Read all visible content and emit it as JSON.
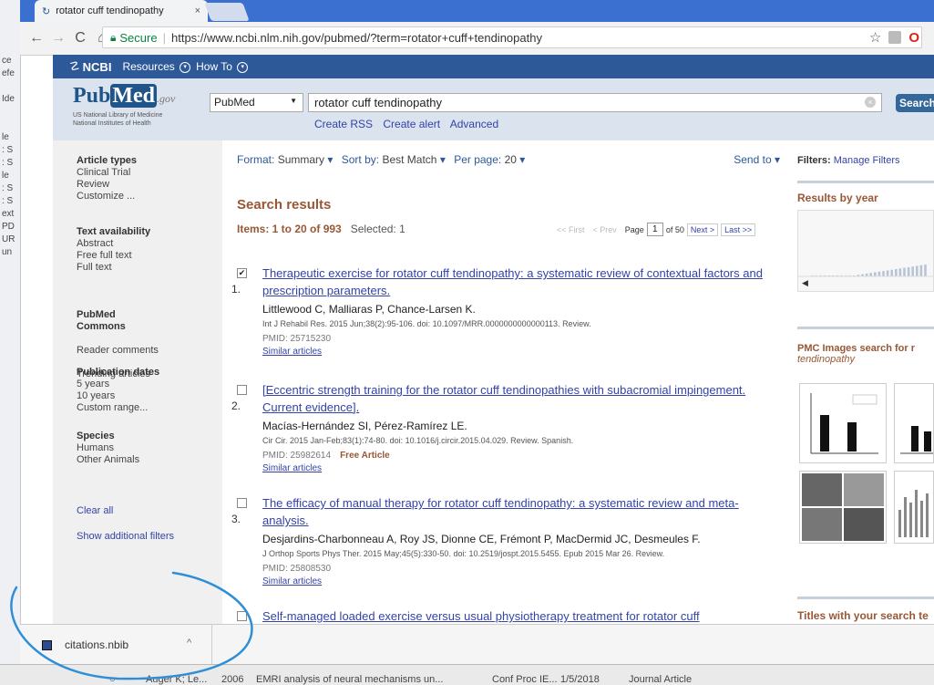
{
  "bg_window": {
    "lines": [
      "ce",
      "efe",
      "",
      "Ide",
      "",
      "",
      "le",
      ": S",
      ": S",
      "le",
      ": S",
      ": S",
      "ext",
      "PD",
      "UR",
      "un"
    ]
  },
  "browser": {
    "tab_title": "rotator cuff tendinopathy",
    "tab_close": "×",
    "secure_label": "Secure",
    "url": "https://www.ncbi.nlm.nih.gov/pubmed/?term=rotator+cuff+tendinopathy"
  },
  "ncbi": {
    "logo": "NCBI",
    "resources": "Resources",
    "howto": "How To"
  },
  "header": {
    "logo_pub": "Pub",
    "logo_med": "Med",
    "logo_gov": ".gov",
    "logo_sub1": "US National Library of Medicine",
    "logo_sub2": "National Institutes of Health",
    "database": "PubMed",
    "query": "rotator cuff tendinopathy",
    "search_label": "Search",
    "links": [
      "Create RSS",
      "Create alert",
      "Advanced"
    ]
  },
  "sidebar": {
    "sections": [
      {
        "title": "Article types",
        "items": [
          "Clinical Trial",
          "Review",
          "Customize ..."
        ]
      },
      {
        "title": "Text availability",
        "items": [
          "Abstract",
          "Free full text",
          "Full text"
        ]
      },
      {
        "title": "PubMed\nCommons",
        "items": [
          "Reader comments",
          "Trending articles"
        ]
      },
      {
        "title": "Publication dates",
        "items": [
          "5 years",
          "10 years",
          "Custom range..."
        ]
      },
      {
        "title": "Species",
        "items": [
          "Humans",
          "Other Animals"
        ]
      }
    ],
    "clear_all": "Clear all",
    "show_filters": "Show additional filters"
  },
  "results_bar": {
    "format_label": "Format:",
    "format_value": "Summary",
    "sort_label": "Sort by:",
    "sort_value": "Best Match",
    "perpage_label": "Per page:",
    "perpage_value": "20",
    "send_to": "Send to"
  },
  "results": {
    "title": "Search results",
    "items_label": "Items: 1 to 20 of 993",
    "selected": "Selected: 1",
    "pager": {
      "first": "<< First",
      "prev": "< Prev",
      "page_label": "Page",
      "page": "1",
      "of": "of 50",
      "next": "Next >",
      "last": "Last >>"
    },
    "list": [
      {
        "num": "1.",
        "checked": true,
        "title": "Therapeutic exercise for rotator cuff tendinopathy: a systematic review of contextual factors and prescription parameters.",
        "authors": "Littlewood C, Malliaras P, Chance-Larsen K.",
        "citation": "Int J Rehabil Res. 2015 Jun;38(2):95-106. doi: 10.1097/MRR.0000000000000113. Review.",
        "pmid": "PMID: 25715230",
        "free": "",
        "similar": "Similar articles"
      },
      {
        "num": "2.",
        "checked": false,
        "title": "[Eccentric strength training for the rotator cuff tendinopathies with subacromial impingement. Current evidence].",
        "authors": "Macías-Hernández SI, Pérez-Ramírez LE.",
        "citation": "Cir Cir. 2015 Jan-Feb;83(1):74-80. doi: 10.1016/j.circir.2015.04.029. Review. Spanish.",
        "pmid": "PMID: 25982614",
        "free": "Free Article",
        "similar": "Similar articles"
      },
      {
        "num": "3.",
        "checked": false,
        "title": "The efficacy of manual therapy for rotator cuff tendinopathy: a systematic review and meta-analysis.",
        "authors": "Desjardins-Charbonneau A, Roy JS, Dionne CE, Frémont P, MacDermid JC, Desmeules F.",
        "citation": "J Orthop Sports Phys Ther. 2015 May;45(5):330-50. doi: 10.2519/jospt.2015.5455. Epub 2015 Mar 26. Review.",
        "pmid": "PMID: 25808530",
        "free": "",
        "similar": "Similar articles"
      },
      {
        "num": "",
        "checked": false,
        "title": "Self-managed loaded exercise versus usual physiotherapy treatment for rotator cuff",
        "authors": "",
        "citation": "",
        "pmid": "",
        "free": "",
        "similar": ""
      }
    ]
  },
  "right": {
    "filters_label": "Filters:",
    "manage_filters": "Manage Filters",
    "results_by_year": "Results by year",
    "pmc_title": "PMC Images search for r",
    "pmc_sub": "tendinopathy",
    "titles_search": "Titles with your search te"
  },
  "download": {
    "filename": "citations.nbib"
  },
  "bottom_row": {
    "author": "Auger K; Le...",
    "year": "2006",
    "title": "EMRI analysis of neural mechanisms un...",
    "venue": "Conf Proc IE...",
    "date": "1/5/2018",
    "type": "Journal Article"
  },
  "colors": {
    "ncbi_blue": "#2e5999",
    "accent_brown": "#985735",
    "link": "#3343a8",
    "annotation": "#2f8fd6"
  }
}
